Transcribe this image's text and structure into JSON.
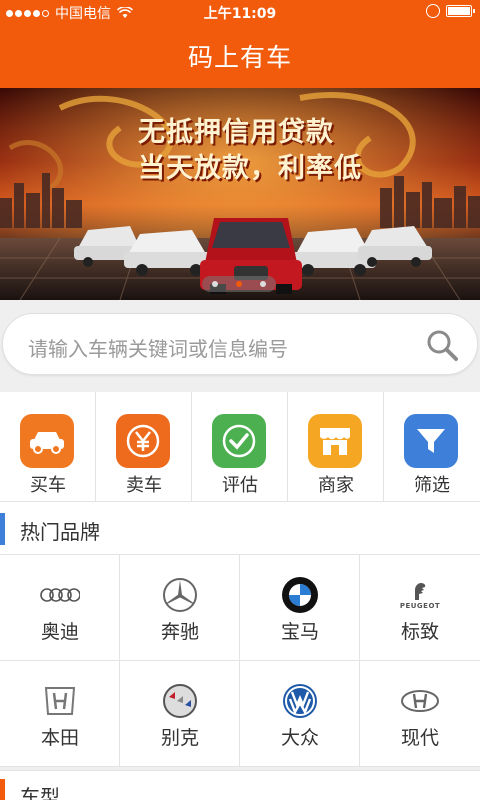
{
  "status_bar": {
    "carrier": "中国电信",
    "time": "上午11:09"
  },
  "header": {
    "title": "码上有车"
  },
  "banner": {
    "line1": "无抵押信用贷款",
    "line2": "当天放款，利率低"
  },
  "search": {
    "placeholder": "请输入车辆关键词或信息编号"
  },
  "quick_menu": [
    {
      "label": "买车",
      "icon": "car-icon",
      "color": "#f07820"
    },
    {
      "label": "卖车",
      "icon": "yen-icon",
      "color": "#ee6a1c"
    },
    {
      "label": "评估",
      "icon": "check-icon",
      "color": "#4caf50"
    },
    {
      "label": "商家",
      "icon": "store-icon",
      "color": "#f5a623"
    },
    {
      "label": "筛选",
      "icon": "filter-icon",
      "color": "#3d7fd9"
    }
  ],
  "sections": {
    "hot_brands": "热门品牌",
    "car_models": "车型"
  },
  "brands": [
    {
      "label": "奥迪",
      "icon": "audi-logo-icon"
    },
    {
      "label": "奔驰",
      "icon": "benz-logo-icon"
    },
    {
      "label": "宝马",
      "icon": "bmw-logo-icon"
    },
    {
      "label": "标致",
      "icon": "peugeot-logo-icon",
      "logo_text": "PEUGEOT"
    },
    {
      "label": "本田",
      "icon": "honda-logo-icon"
    },
    {
      "label": "别克",
      "icon": "buick-logo-icon"
    },
    {
      "label": "大众",
      "icon": "vw-logo-icon"
    },
    {
      "label": "现代",
      "icon": "hyundai-logo-icon"
    }
  ],
  "colors": {
    "accent": "#f25a0c",
    "section_bar_blue": "#3d7fd9",
    "section_bar_orange": "#f25a0c"
  }
}
